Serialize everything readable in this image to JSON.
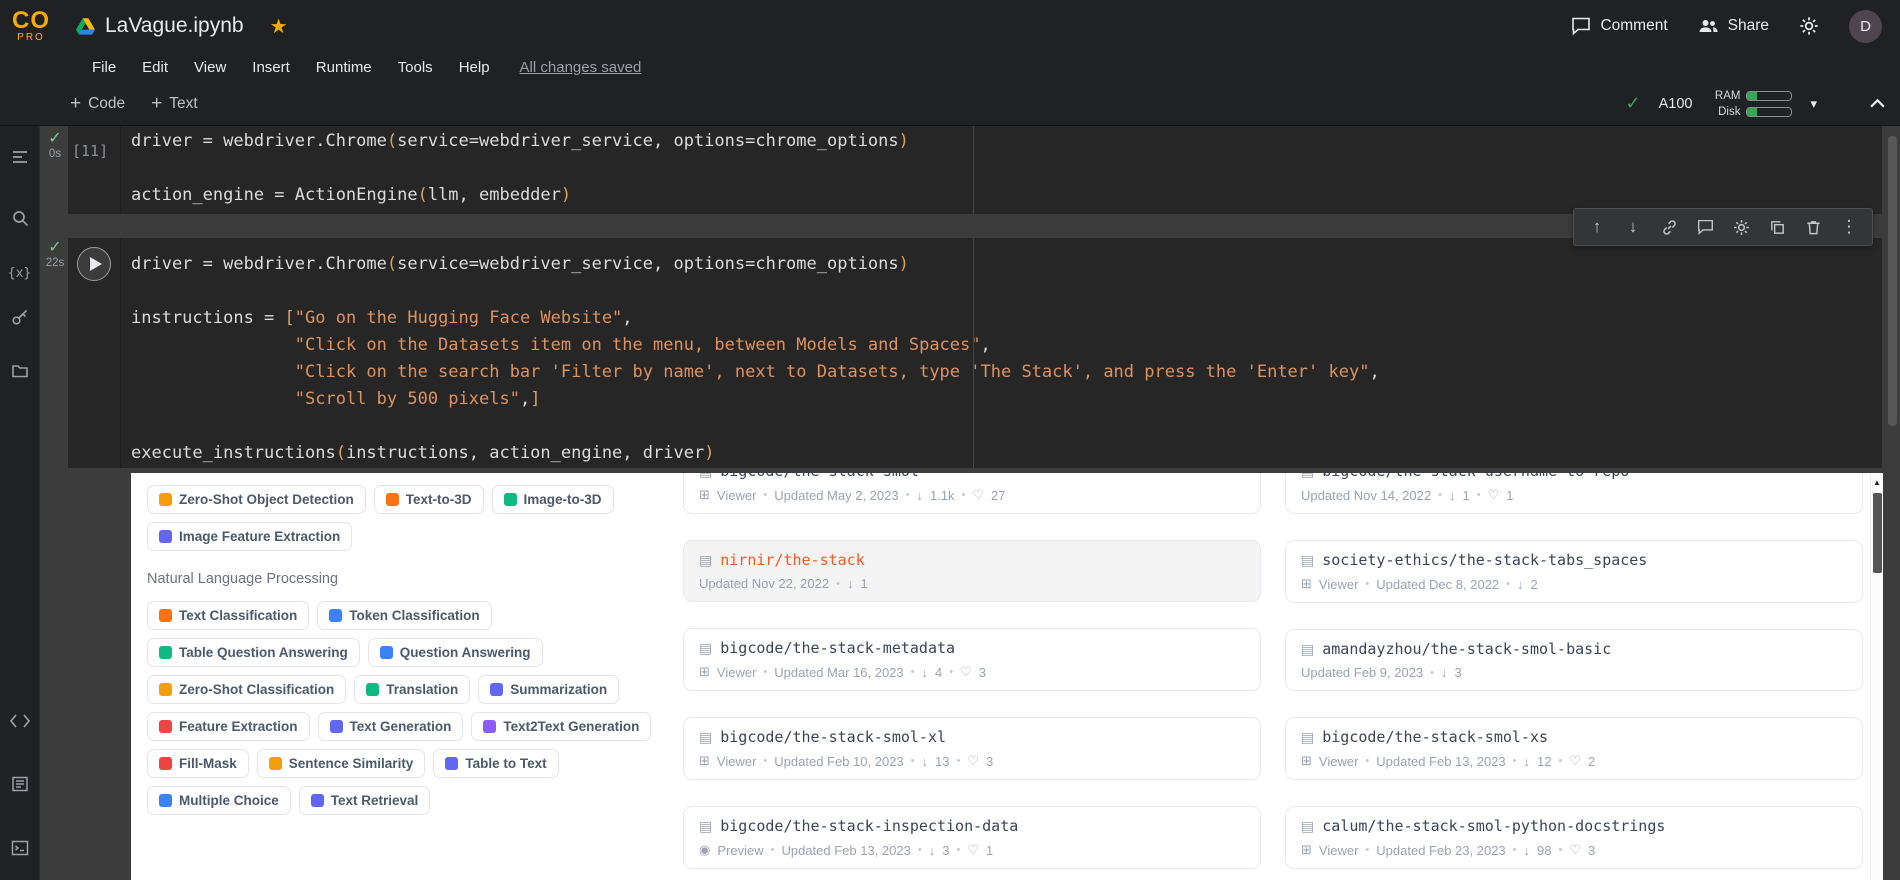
{
  "header": {
    "logo_co": "CO",
    "logo_pro": "PRO",
    "title": "LaVague.ipynb",
    "menus": [
      "File",
      "Edit",
      "View",
      "Insert",
      "Runtime",
      "Tools",
      "Help"
    ],
    "save_status": "All changes saved",
    "comment": "Comment",
    "share": "Share",
    "avatar": "D"
  },
  "toolbar": {
    "add_code": "Code",
    "add_text": "Text",
    "accelerator": "A100",
    "ram": "RAM",
    "disk": "Disk"
  },
  "icons": {
    "star": "★",
    "check": "✓",
    "plus": "+",
    "arrow_up": "↑",
    "arrow_down": "↓",
    "more_vert": "⋮",
    "caret_down": "▾",
    "scroll_up_arrow": "▲",
    "variables": "{x}",
    "dataset": "▤",
    "viewer": "⊞",
    "preview": "◉",
    "download": "↓",
    "like": "♡"
  },
  "cells": [
    {
      "exec_time": "0s",
      "exec_count": "[11]",
      "lines": [
        [
          [
            "pln",
            "driver = webdriver.Chrome"
          ],
          [
            "par",
            "("
          ],
          [
            "pln",
            "service=webdriver_service, options=chrome_options"
          ],
          [
            "par",
            ")"
          ]
        ],
        [],
        [
          [
            "pln",
            "action_engine = ActionEngine"
          ],
          [
            "par",
            "("
          ],
          [
            "pln",
            "llm, embedder"
          ],
          [
            "par",
            ")"
          ]
        ]
      ]
    },
    {
      "exec_time": "22s",
      "lines": [
        [
          [
            "pln",
            "driver = webdriver.Chrome"
          ],
          [
            "par",
            "("
          ],
          [
            "pln",
            "service=webdriver_service, options=chrome_options"
          ],
          [
            "par",
            ")"
          ]
        ],
        [],
        [
          [
            "pln",
            "instructions = "
          ],
          [
            "par",
            "["
          ],
          [
            "str",
            "\"Go on the Hugging Face Website\""
          ],
          [
            "pln",
            ","
          ]
        ],
        [
          [
            "pln",
            "                "
          ],
          [
            "str",
            "\"Click on the Datasets item on the menu, between Models and Spaces\""
          ],
          [
            "pln",
            ","
          ]
        ],
        [
          [
            "pln",
            "                "
          ],
          [
            "str",
            "\"Click on the search bar 'Filter by name', next to Datasets, type 'The Stack', and press the 'Enter' key\""
          ],
          [
            "pln",
            ","
          ]
        ],
        [
          [
            "pln",
            "                "
          ],
          [
            "str",
            "\"Scroll by 500 pixels\""
          ],
          [
            "pln",
            ","
          ],
          [
            "par",
            "]"
          ]
        ],
        [],
        [
          [
            "pln",
            "execute_instructions"
          ],
          [
            "par",
            "("
          ],
          [
            "pln",
            "instructions, action_engine, driver"
          ],
          [
            "par",
            ")"
          ]
        ]
      ]
    }
  ],
  "output": {
    "highlight_color": "#f05a28",
    "filter_groups": [
      {
        "header": null,
        "pills": [
          {
            "label": "Zero-Shot Object Detection",
            "color": "#f59e0b"
          },
          {
            "label": "Text-to-3D",
            "color": "#f97316"
          },
          {
            "label": "Image-to-3D",
            "color": "#10b981"
          },
          {
            "label": "Image Feature Extraction",
            "color": "#6366f1"
          }
        ]
      },
      {
        "header": "Natural Language Processing",
        "pills": [
          {
            "label": "Text Classification",
            "color": "#f97316"
          },
          {
            "label": "Token Classification",
            "color": "#3b82f6"
          },
          {
            "label": "Table Question Answering",
            "color": "#10b981"
          },
          {
            "label": "Question Answering",
            "color": "#3b82f6"
          },
          {
            "label": "Zero-Shot Classification",
            "color": "#f59e0b"
          },
          {
            "label": "Translation",
            "color": "#10b981"
          },
          {
            "label": "Summarization",
            "color": "#6366f1"
          },
          {
            "label": "Feature Extraction",
            "color": "#ef4444"
          },
          {
            "label": "Text Generation",
            "color": "#6366f1"
          },
          {
            "label": "Text2Text Generation",
            "color": "#8b5cf6"
          },
          {
            "label": "Fill-Mask",
            "color": "#ef4444"
          },
          {
            "label": "Sentence Similarity",
            "color": "#f59e0b"
          },
          {
            "label": "Table to Text",
            "color": "#6366f1"
          },
          {
            "label": "Multiple Choice",
            "color": "#3b82f6"
          },
          {
            "label": "Text Retrieval",
            "color": "#6366f1"
          }
        ]
      }
    ],
    "columns": [
      [
        {
          "title": "bigcode/the-stack-smol",
          "viewer": "Viewer",
          "updated": "Updated May 2, 2023",
          "downloads": "1.1k",
          "likes": "27",
          "clipped": true
        },
        {
          "title": "nirnir/the-stack",
          "updated": "Updated Nov 22, 2022",
          "downloads": "1",
          "highlight": true
        },
        {
          "title": "bigcode/the-stack-metadata",
          "viewer": "Viewer",
          "updated": "Updated Mar 16, 2023",
          "downloads": "4",
          "likes": "3"
        },
        {
          "title": "bigcode/the-stack-smol-xl",
          "viewer": "Viewer",
          "updated": "Updated Feb 10, 2023",
          "downloads": "13",
          "likes": "3"
        },
        {
          "title": "bigcode/the-stack-inspection-data",
          "viewer": "Preview",
          "updated": "Updated Feb 13, 2023",
          "downloads": "3",
          "likes": "1"
        }
      ],
      [
        {
          "title": "bigcode/the-stack-username-to-repo",
          "updated": "Updated Nov 14, 2022",
          "downloads": "1",
          "likes": "1",
          "clipped": true
        },
        {
          "title": "society-ethics/the-stack-tabs_spaces",
          "viewer": "Viewer",
          "updated": "Updated Dec 8, 2022",
          "downloads": "2"
        },
        {
          "title": "amandayzhou/the-stack-smol-basic",
          "updated": "Updated Feb 9, 2023",
          "downloads": "3"
        },
        {
          "title": "bigcode/the-stack-smol-xs",
          "viewer": "Viewer",
          "updated": "Updated Feb 13, 2023",
          "downloads": "12",
          "likes": "2"
        },
        {
          "title": "calum/the-stack-smol-python-docstrings",
          "viewer": "Viewer",
          "updated": "Updated Feb 23, 2023",
          "downloads": "98",
          "likes": "3"
        }
      ]
    ]
  }
}
